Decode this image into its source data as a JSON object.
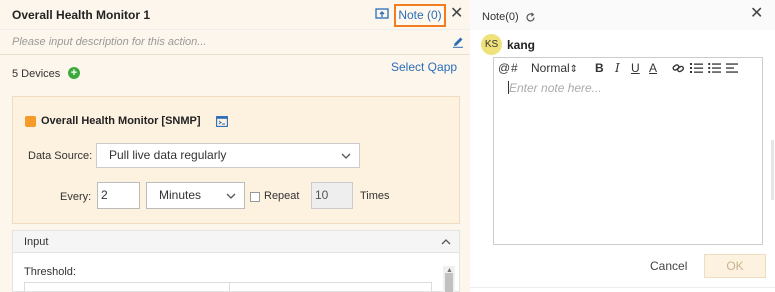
{
  "action": {
    "title": "Overall Health Monitor 1",
    "note_button": "Note (0)",
    "close_glyph": "✕",
    "description_placeholder": "Please input description for this action...",
    "devices_label": "5 Devices",
    "add_glyph": "+",
    "select_qapp": "Select Qapp"
  },
  "card": {
    "title": "Overall Health Monitor [SNMP]",
    "data_source_label": "Data Source:",
    "data_source_value": "Pull live data regularly",
    "every_label": "Every:",
    "every_value": "2",
    "unit_value": "Minutes",
    "repeat_label": "Repeat",
    "repeat_checked": false,
    "times_value": "10",
    "times_label": "Times"
  },
  "input_panel": {
    "title": "Input",
    "threshold_label": "Threshold:"
  },
  "note_panel": {
    "title": "Note(0)",
    "close_glyph": "✕",
    "avatar_initials": "KS",
    "username": "kang",
    "toolbar": {
      "at": "@",
      "hash": "#",
      "style": "Normal",
      "style_arrows": "⇕",
      "bold": "B",
      "italic": "I",
      "underline": "U",
      "color": "A"
    },
    "editor_placeholder": "Enter note here...",
    "cancel": "Cancel",
    "ok": "OK"
  },
  "colors": {
    "accent_orange": "#f07c23",
    "link_blue": "#2a6db8",
    "panel_cream": "#fdf6ec",
    "add_green": "#3caa3c"
  }
}
